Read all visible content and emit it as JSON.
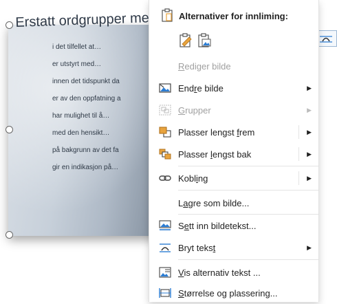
{
  "image_text": {
    "title": "Erstatt ordgrupper me",
    "lines": [
      "i det tilfellet at…",
      "er utstyrt med…",
      "innen det tidspunkt da",
      "er av den oppfatning a",
      "har mulighet til å…",
      "med den hensikt…",
      "på bakgrunn av det fa",
      "gir en indikasjon på…"
    ]
  },
  "menu": {
    "paste_header": "Alternativer for innliming:",
    "items": [
      {
        "pre": "",
        "u": "R",
        "post": "ediger bilde",
        "disabled": true,
        "submenu": false,
        "icon": "none"
      },
      {
        "pre": "End",
        "u": "r",
        "post": "e bilde",
        "disabled": false,
        "submenu": true,
        "icon": "change-picture-icon"
      },
      {
        "pre": "",
        "u": "G",
        "post": "rupper",
        "disabled": true,
        "submenu": true,
        "icon": "group-icon"
      },
      {
        "pre": "Plasser lengst ",
        "u": "f",
        "post": "rem",
        "disabled": false,
        "submenu": true,
        "icon": "bring-to-front-icon"
      },
      {
        "pre": "Plasser ",
        "u": "l",
        "post": "engst bak",
        "disabled": false,
        "submenu": true,
        "icon": "send-to-back-icon"
      },
      {
        "pre": "Kobl",
        "u": "i",
        "post": "ng",
        "disabled": false,
        "submenu": true,
        "icon": "link-icon"
      },
      {
        "pre": "L",
        "u": "a",
        "post": "gre som bilde...",
        "disabled": false,
        "submenu": false,
        "icon": "none"
      },
      {
        "pre": "S",
        "u": "e",
        "post": "tt inn bildetekst...",
        "disabled": false,
        "submenu": false,
        "icon": "insert-caption-icon"
      },
      {
        "pre": "Bryt teks",
        "u": "t",
        "post": "",
        "disabled": false,
        "submenu": true,
        "icon": "wrap-text-icon"
      },
      {
        "pre": "",
        "u": "V",
        "post": "is alternativ tekst ...",
        "disabled": false,
        "submenu": false,
        "icon": "alt-text-icon"
      },
      {
        "pre": "",
        "u": "S",
        "post": "tørrelse og plassering...",
        "disabled": false,
        "submenu": false,
        "icon": "size-position-icon"
      }
    ]
  },
  "colors": {
    "accent": "#2b7cd3",
    "orange": "#e8a33d",
    "menu_text": "#222222",
    "disabled_text": "#a0a0a0"
  }
}
